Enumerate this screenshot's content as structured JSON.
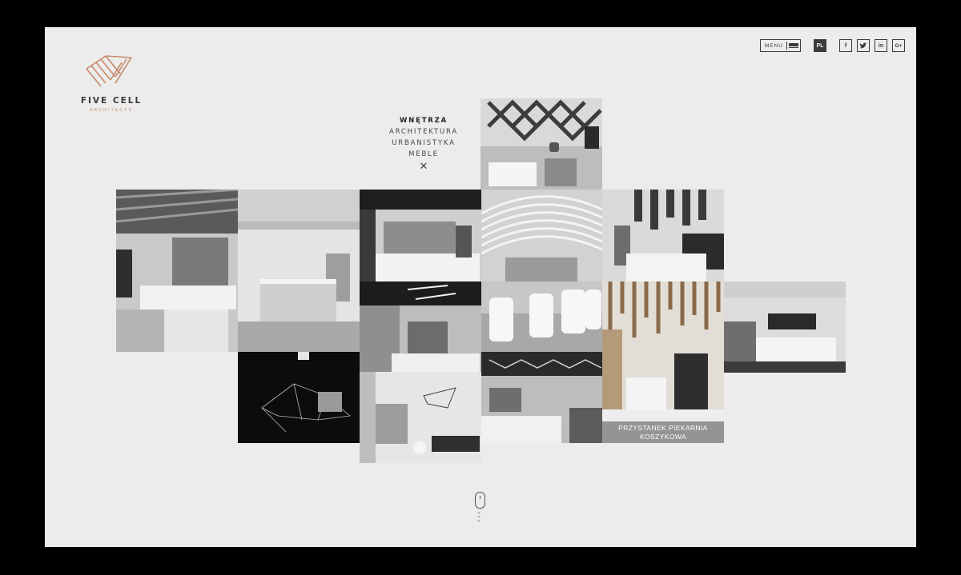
{
  "brand": {
    "name": "FIVE CELL",
    "subtitle": "ARCHITECTS",
    "accent_color": "#c48a6a"
  },
  "topnav": {
    "menu_label": "MENU",
    "language": "PL",
    "social": [
      {
        "label": "f",
        "icon": "facebook-icon"
      },
      {
        "label": "t",
        "icon": "twitter-icon"
      },
      {
        "label": "in",
        "icon": "linkedin-icon"
      },
      {
        "label": "G+",
        "icon": "google-plus-icon"
      }
    ]
  },
  "categories": {
    "items": [
      "WNĘTRZA",
      "ARCHITEKTURA",
      "URBANISTYKA",
      "MEBLE"
    ],
    "active": "WNĘTRZA",
    "close_icon": "close-icon"
  },
  "projects": {
    "highlight_caption_line1": "PRZYSTANEK PIEKARNIA",
    "highlight_caption_line2": "KOSZYKOWA"
  },
  "scroll_hint": {
    "icon": "mouse-scroll-icon"
  }
}
